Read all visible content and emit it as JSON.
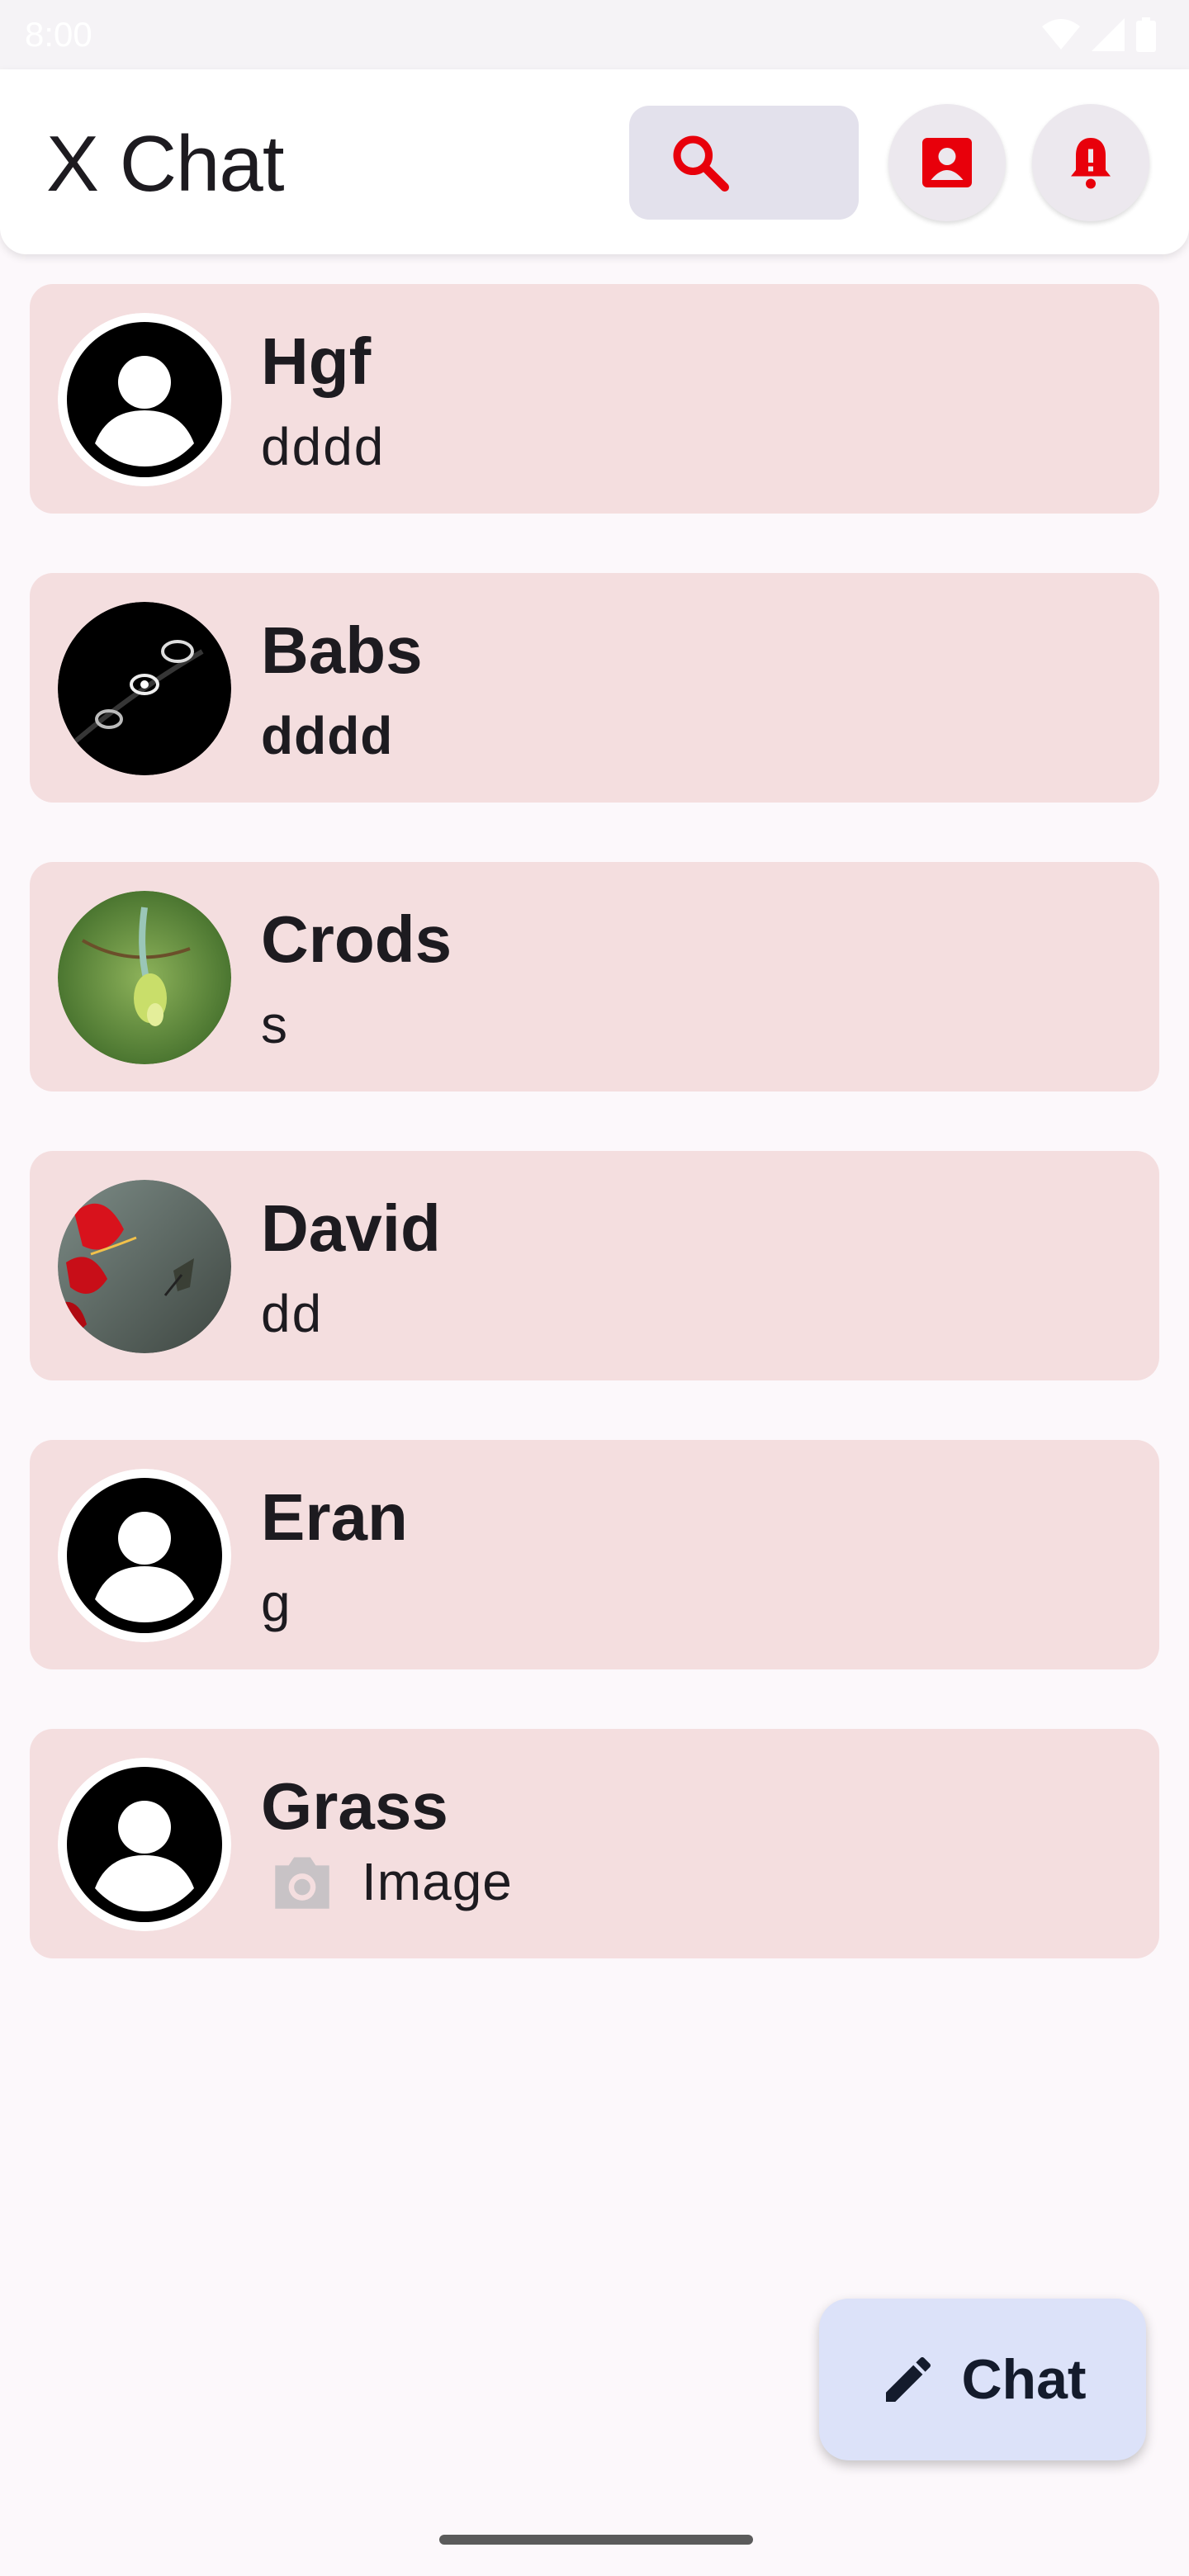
{
  "status_bar": {
    "time": "8:00"
  },
  "app_bar": {
    "title": "X Chat",
    "accent_color": "#E8000B"
  },
  "chats": [
    {
      "name": "Hgf",
      "preview": "dddd",
      "unread": false,
      "avatar": "default-avatar"
    },
    {
      "name": "Babs",
      "preview": "dddd",
      "unread": true,
      "avatar": "photo-avatar-space"
    },
    {
      "name": "Crods",
      "preview": "s",
      "unread": false,
      "avatar": "photo-avatar-bird"
    },
    {
      "name": "David",
      "preview": "dd",
      "unread": false,
      "avatar": "photo-avatar-hummingbird"
    },
    {
      "name": "Eran",
      "preview": "g",
      "unread": false,
      "avatar": "default-avatar"
    },
    {
      "name": "Grass",
      "preview": "Image",
      "unread": false,
      "avatar": "default-avatar",
      "preview_icon": "camera-icon"
    }
  ],
  "fab": {
    "label": "Chat",
    "icon": "pencil-icon"
  }
}
